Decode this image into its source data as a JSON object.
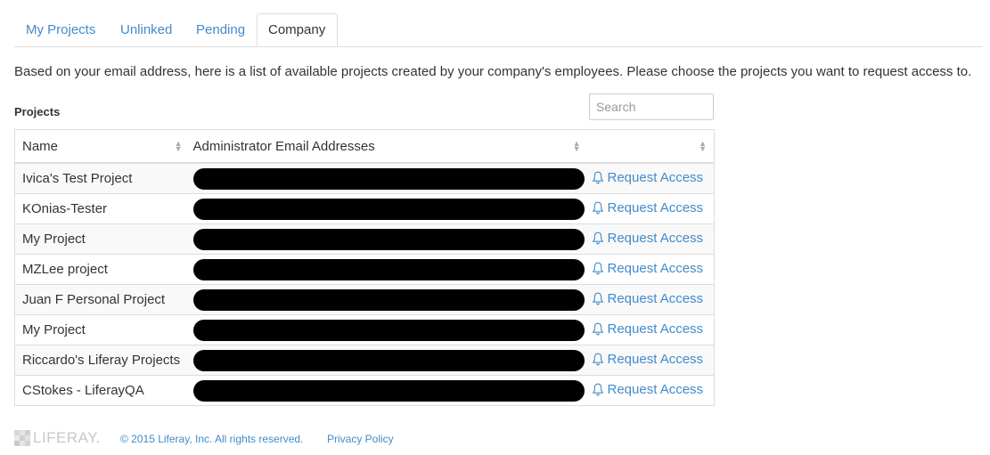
{
  "tabs": [
    {
      "label": "My Projects",
      "active": false
    },
    {
      "label": "Unlinked",
      "active": false
    },
    {
      "label": "Pending",
      "active": false
    },
    {
      "label": "Company",
      "active": true
    }
  ],
  "intro_text": "Based on your email address, here is a list of available projects created by your company's employees. Please choose the projects you want to request access to.",
  "projects_label": "Projects",
  "search": {
    "placeholder": "Search",
    "value": ""
  },
  "table": {
    "columns": [
      "Name",
      "Administrator Email Addresses",
      ""
    ],
    "rows": [
      {
        "name": "Ivica's Test Project",
        "admin": "[redacted]",
        "action": "Request Access"
      },
      {
        "name": "KOnias-Tester",
        "admin": "[redacted]",
        "action": "Request Access"
      },
      {
        "name": "My Project",
        "admin": "[redacted]",
        "action": "Request Access"
      },
      {
        "name": "MZLee project",
        "admin": "[redacted]",
        "action": "Request Access"
      },
      {
        "name": "Juan F Personal Project",
        "admin": "[redacted]",
        "action": "Request Access"
      },
      {
        "name": "My Project",
        "admin": "[redacted]",
        "action": "Request Access"
      },
      {
        "name": "Riccardo's Liferay Projects",
        "admin": "[redacted]",
        "action": "Request Access"
      },
      {
        "name": "CStokes - LiferayQA",
        "admin": "[redacted]",
        "action": "Request Access"
      }
    ]
  },
  "footer": {
    "logo_text": "LIFERAY.",
    "copyright": "© 2015 Liferay, Inc. All rights reserved.",
    "privacy": "Privacy Policy"
  },
  "colors": {
    "link": "#428bca",
    "text": "#333333",
    "border": "#dddddd",
    "stripe": "#f9f9f9"
  },
  "icons": {
    "request": "bell-icon",
    "sort": "sort-icon"
  }
}
